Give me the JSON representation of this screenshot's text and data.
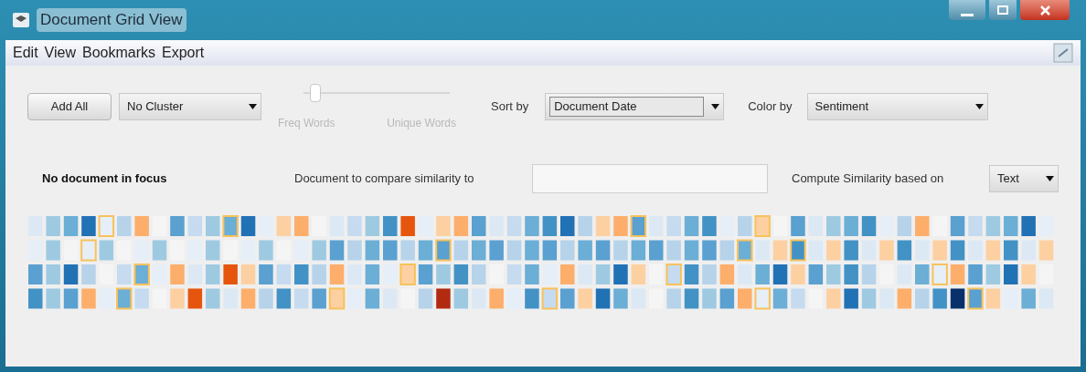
{
  "window": {
    "title": "Document Grid View"
  },
  "menu": [
    "Edit",
    "View",
    "Bookmarks",
    "Export"
  ],
  "toolbar": {
    "add_all": "Add All",
    "cluster": {
      "value": "No Cluster"
    },
    "slider": {
      "level": 0.05,
      "left_label": "Freq Words",
      "right_label": "Unique Words"
    },
    "sort": {
      "label": "Sort by",
      "value": "Document Date"
    },
    "color": {
      "label": "Color by",
      "value": "Sentiment"
    }
  },
  "focus": {
    "status": "No document in focus",
    "compare_label": "Document to compare similarity to",
    "similarity_label": "Compute Similarity based on",
    "similarity": {
      "value": "Text"
    }
  }
}
